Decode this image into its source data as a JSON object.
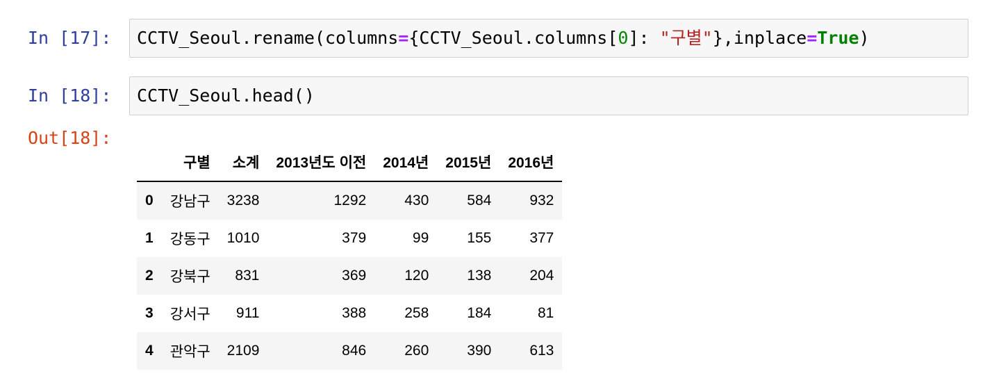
{
  "cells": [
    {
      "prompt": "In [17]:",
      "code_tokens": [
        {
          "t": "CCTV_Seoul.rename(columns",
          "c": "plain"
        },
        {
          "t": "=",
          "c": "op"
        },
        {
          "t": "{CCTV_Seoul.columns[",
          "c": "plain"
        },
        {
          "t": "0",
          "c": "num"
        },
        {
          "t": "]: ",
          "c": "plain"
        },
        {
          "t": "\"구별\"",
          "c": "str"
        },
        {
          "t": "},inplace",
          "c": "plain"
        },
        {
          "t": "=",
          "c": "op"
        },
        {
          "t": "True",
          "c": "kw"
        },
        {
          "t": ")",
          "c": "plain"
        }
      ]
    },
    {
      "prompt": "In [18]:",
      "code_tokens": [
        {
          "t": "CCTV_Seoul.head()",
          "c": "plain"
        }
      ]
    }
  ],
  "output": {
    "prompt": "Out[18]:",
    "table": {
      "columns": [
        "",
        "구별",
        "소계",
        "2013년도 이전",
        "2014년",
        "2015년",
        "2016년"
      ],
      "rows": [
        [
          "0",
          "강남구",
          "3238",
          "1292",
          "430",
          "584",
          "932"
        ],
        [
          "1",
          "강동구",
          "1010",
          "379",
          "99",
          "155",
          "377"
        ],
        [
          "2",
          "강북구",
          "831",
          "369",
          "120",
          "138",
          "204"
        ],
        [
          "3",
          "강서구",
          "911",
          "388",
          "258",
          "184",
          "81"
        ],
        [
          "4",
          "관악구",
          "2109",
          "846",
          "260",
          "390",
          "613"
        ]
      ]
    }
  }
}
